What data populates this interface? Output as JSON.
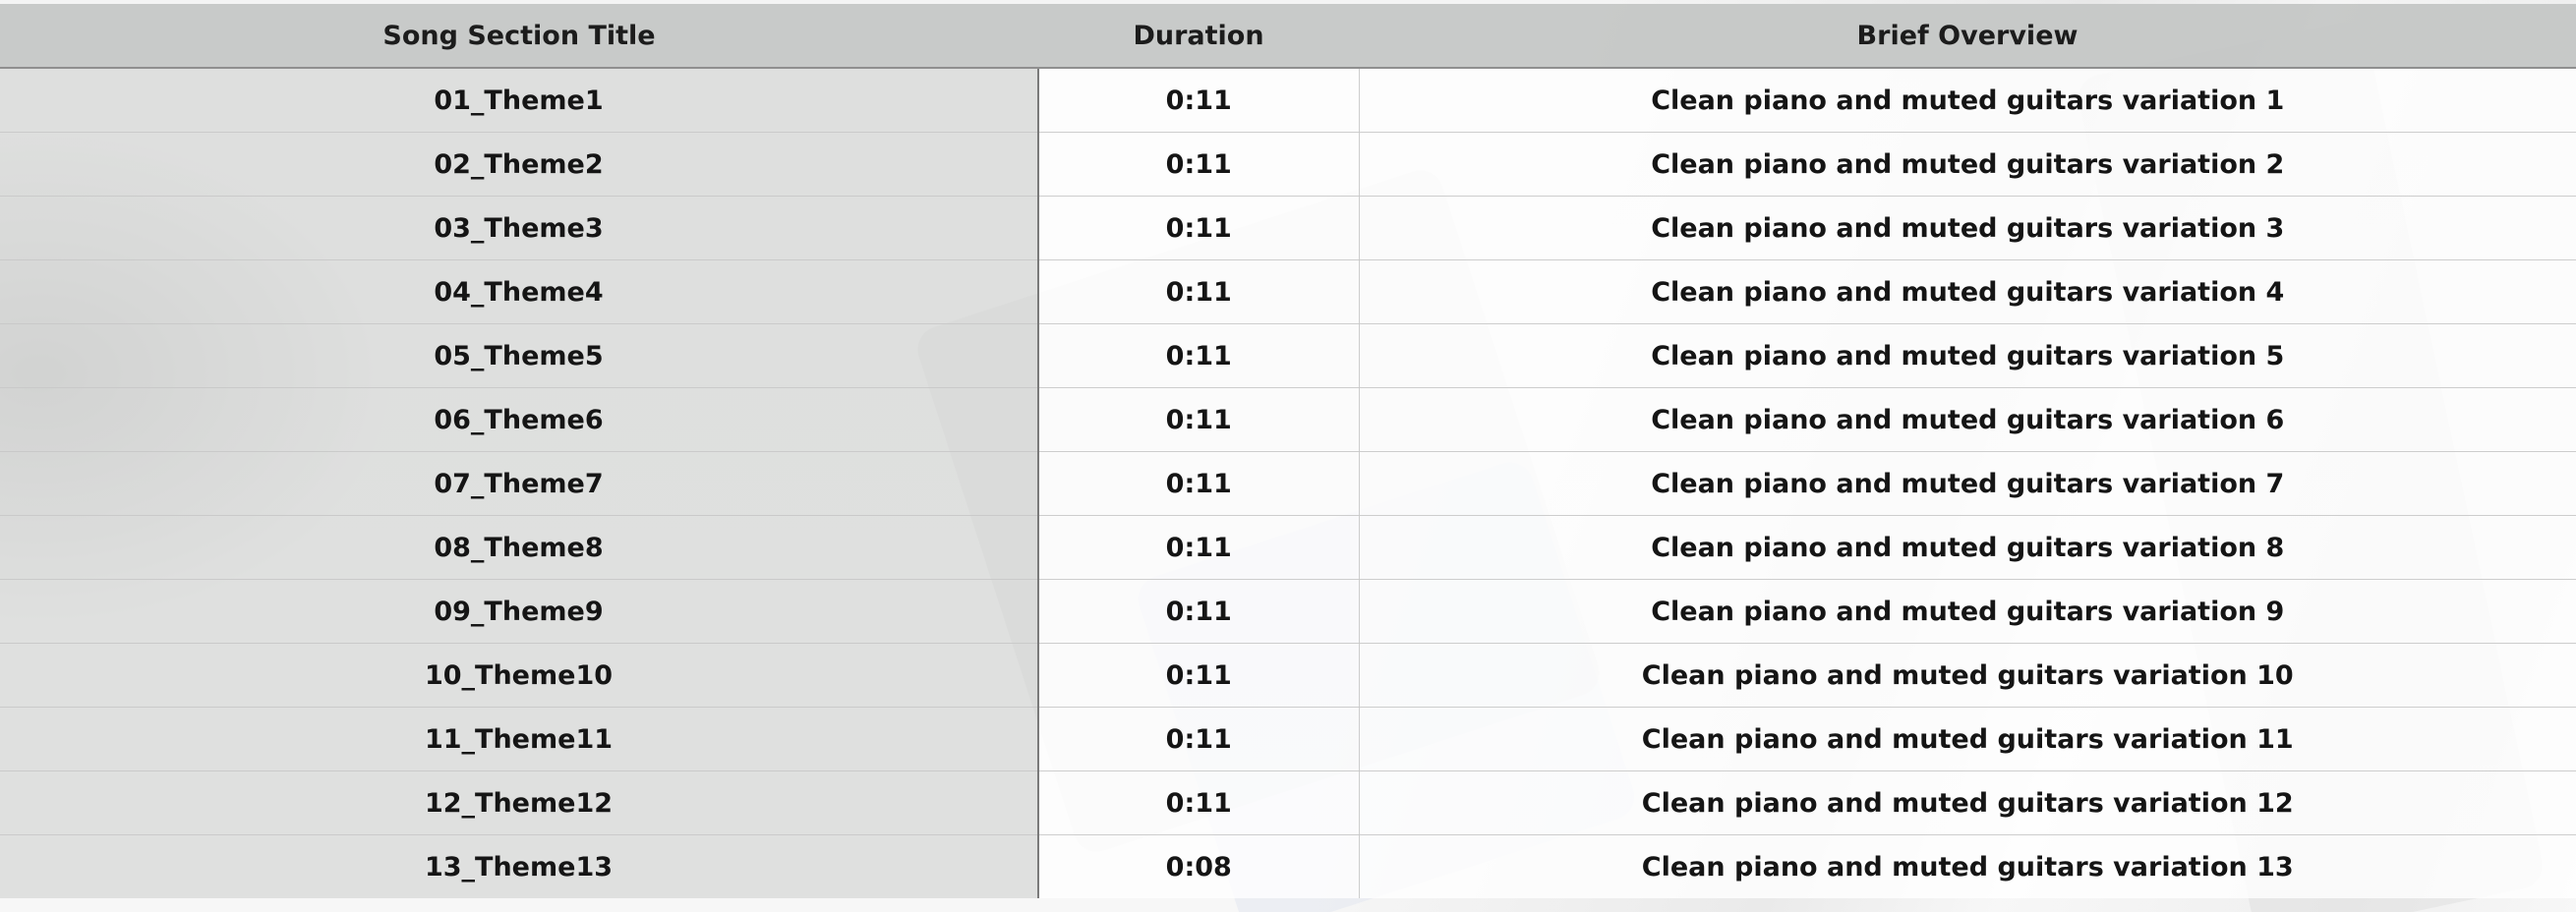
{
  "table": {
    "headers": {
      "title": "Song Section Title",
      "duration": "Duration",
      "overview": "Brief Overview"
    },
    "rows": [
      {
        "title": "01_Theme1",
        "duration": "0:11",
        "overview": "Clean piano and muted guitars variation 1"
      },
      {
        "title": "02_Theme2",
        "duration": "0:11",
        "overview": "Clean piano and muted guitars variation 2"
      },
      {
        "title": "03_Theme3",
        "duration": "0:11",
        "overview": "Clean piano and muted guitars variation 3"
      },
      {
        "title": "04_Theme4",
        "duration": "0:11",
        "overview": "Clean piano and muted guitars variation 4"
      },
      {
        "title": "05_Theme5",
        "duration": "0:11",
        "overview": "Clean piano and muted guitars variation 5"
      },
      {
        "title": "06_Theme6",
        "duration": "0:11",
        "overview": "Clean piano and muted guitars variation 6"
      },
      {
        "title": "07_Theme7",
        "duration": "0:11",
        "overview": "Clean piano and muted guitars variation 7"
      },
      {
        "title": "08_Theme8",
        "duration": "0:11",
        "overview": "Clean piano and muted guitars variation 8"
      },
      {
        "title": "09_Theme9",
        "duration": "0:11",
        "overview": "Clean piano and muted guitars variation 9"
      },
      {
        "title": "10_Theme10",
        "duration": "0:11",
        "overview": "Clean piano and muted guitars variation 10"
      },
      {
        "title": "11_Theme11",
        "duration": "0:11",
        "overview": "Clean piano and muted guitars variation 11"
      },
      {
        "title": "12_Theme12",
        "duration": "0:11",
        "overview": "Clean piano and muted guitars variation 12"
      },
      {
        "title": "13_Theme13",
        "duration": "0:08",
        "overview": "Clean piano and muted guitars variation 13"
      }
    ]
  },
  "colors": {
    "header_bg": "#c3c5c4",
    "text": "#151515",
    "divider": "#7a7a7a"
  }
}
